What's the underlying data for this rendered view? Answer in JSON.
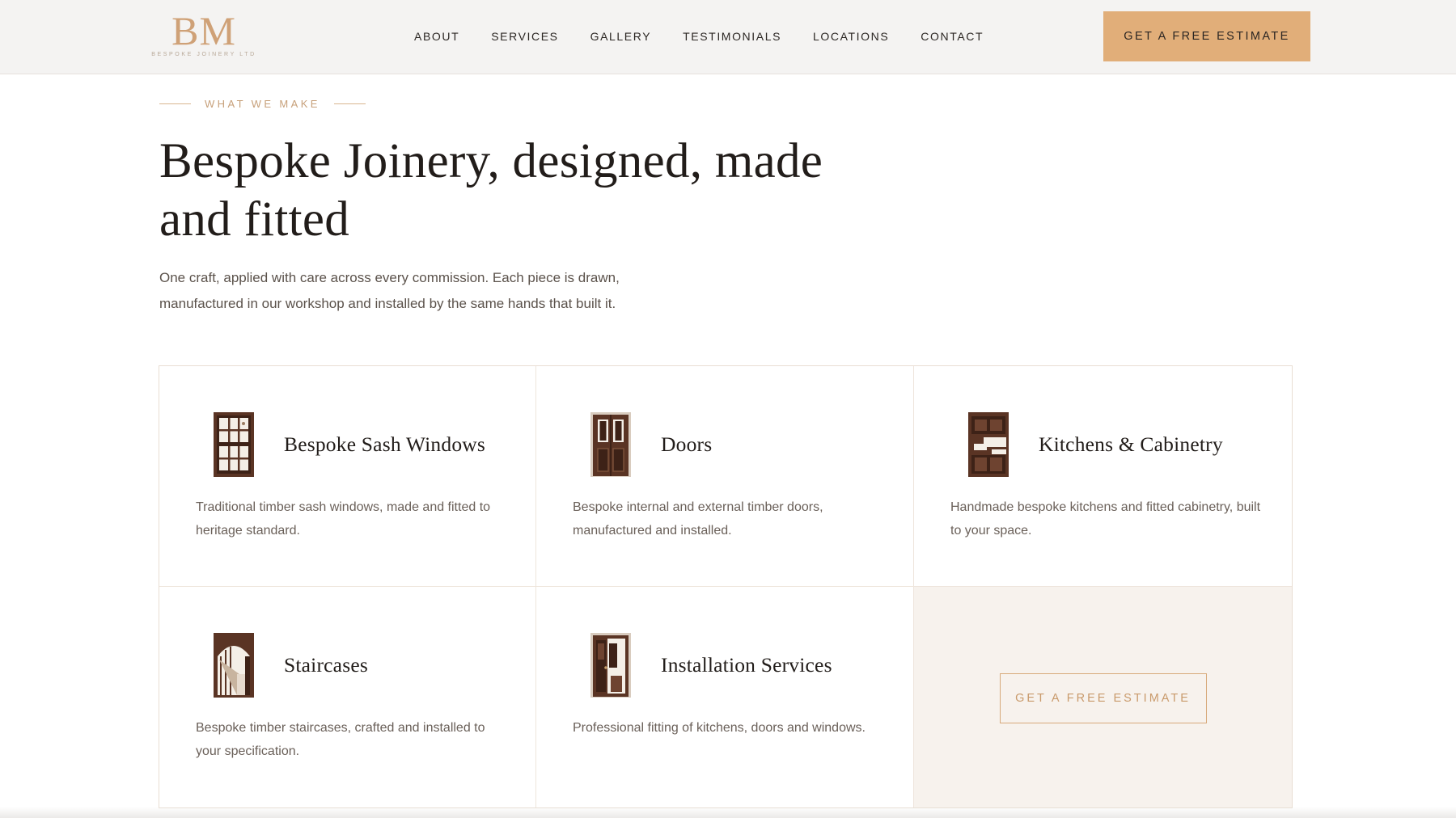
{
  "brand": {
    "logo_mark": "BM",
    "logo_sub": "BESPOKE JOINERY LTD"
  },
  "nav": {
    "items": [
      {
        "label": "ABOUT"
      },
      {
        "label": "SERVICES"
      },
      {
        "label": "GALLERY"
      },
      {
        "label": "TESTIMONIALS"
      },
      {
        "label": "LOCATIONS"
      },
      {
        "label": "CONTACT"
      }
    ],
    "cta_label": "GET A FREE ESTIMATE"
  },
  "intro": {
    "eyebrow": "WHAT WE MAKE",
    "title": "Bespoke Joinery, designed, made and fitted",
    "lead": "One craft, applied with care across every commission. Each piece is drawn, manufactured in our workshop and installed by the same hands that built it."
  },
  "services": [
    {
      "title": "Bespoke Sash Windows",
      "description": "Traditional timber sash windows, made and fitted to heritage standard.",
      "icon": "sash-window-icon"
    },
    {
      "title": "Doors",
      "description": "Bespoke internal and external timber doors, manufactured and installed.",
      "icon": "door-icon"
    },
    {
      "title": "Kitchens & Cabinetry",
      "description": "Handmade bespoke kitchens and fitted cabinetry, built to your space.",
      "icon": "kitchen-cabinet-icon"
    },
    {
      "title": "Staircases",
      "description": "Bespoke timber staircases, crafted and installed to your specification.",
      "icon": "staircase-icon"
    },
    {
      "title": "Installation Services",
      "description": "Professional fitting of kitchens, doors and windows.",
      "icon": "installation-icon"
    }
  ],
  "grid_cta": {
    "label": "GET A FREE ESTIMATE"
  },
  "colors": {
    "accent": "#e1ae79",
    "accent_text": "#c99a6b",
    "header_bg": "#f4f3f2",
    "cta_cell_bg": "#f7f2ed",
    "wood": "#5a3424"
  }
}
